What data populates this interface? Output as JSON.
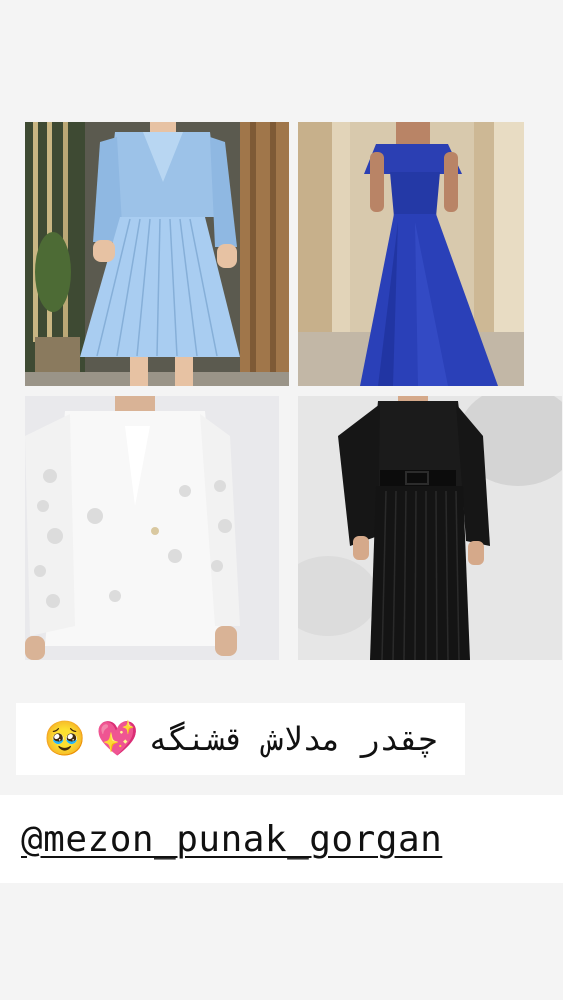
{
  "story": {
    "images": [
      {
        "icon": "light-blue-blazer-pleated-dress-photo"
      },
      {
        "icon": "royal-blue-off-shoulder-gown-photo"
      },
      {
        "icon": "white-lace-blazer-photo"
      },
      {
        "icon": "black-pleated-jumpsuit-photo"
      }
    ],
    "caption": {
      "text": "چقدر مدلاش قشنگه",
      "emoji_1": "💖",
      "emoji_2": "🥹"
    },
    "mention": {
      "text": "@mezon_punak_gorgan",
      "color": "#111111"
    }
  }
}
